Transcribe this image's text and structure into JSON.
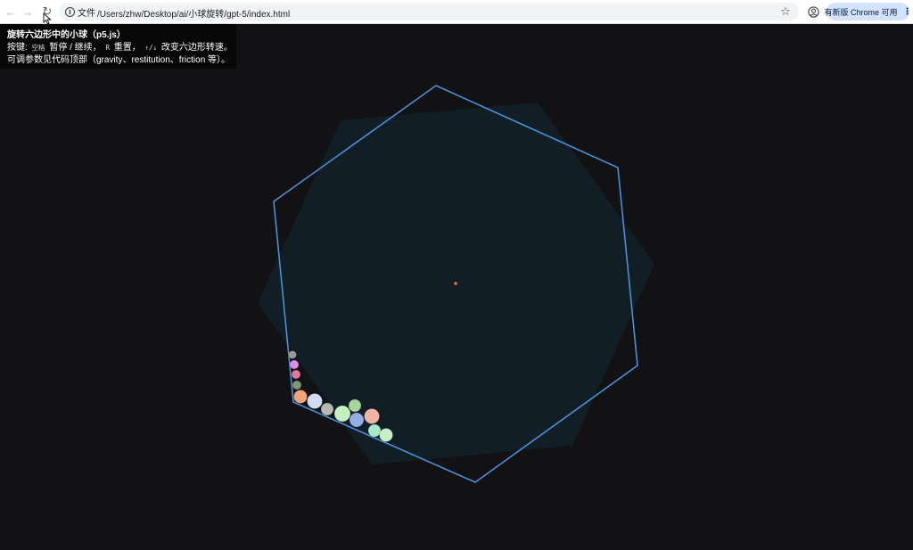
{
  "browser": {
    "site_label": "文件",
    "url": "/Users/zhw/Desktop/ai/小球旋转/gpt-5/index.html",
    "update_button_label": "有新版 Chrome 可用",
    "back_icon": "←",
    "forward_icon": "→",
    "reload_icon": "↻",
    "info_icon": "i",
    "star_icon": "☆",
    "more_icon": "⋮"
  },
  "info": {
    "title": "旋转六边形中的小球（p5.js）",
    "line2_prefix": "按键: ",
    "key_space": "空格",
    "line2_pause": " 暂停 / 继续，",
    "key_r": "R",
    "line2_reset": " 重置，",
    "key_arrows": "↑/↓",
    "line2_speed": " 改变六边形转速。",
    "line3": "可调参数见代码顶部（gravity、restitution、friction 等）。"
  },
  "colors": {
    "background": "#121113",
    "hexagon_stroke": "#4a8fd8",
    "hexagon_shadow_fill": "#121e25",
    "center_dot": "#ff6a3d"
  },
  "balls": [
    {
      "color": "#9c9a98"
    },
    {
      "color": "#e08ce3"
    },
    {
      "color": "#e07a9c"
    },
    {
      "color": "#7c9a72"
    },
    {
      "color": "#f2a27a"
    },
    {
      "color": "#d2dcf2"
    },
    {
      "color": "#b3b8b2"
    },
    {
      "color": "#c5f0c0"
    },
    {
      "color": "#a7d59a"
    },
    {
      "color": "#93aee6"
    },
    {
      "color": "#f3b4a8"
    },
    {
      "color": "#a9e8c8"
    },
    {
      "color": "#c6f1c6"
    }
  ]
}
